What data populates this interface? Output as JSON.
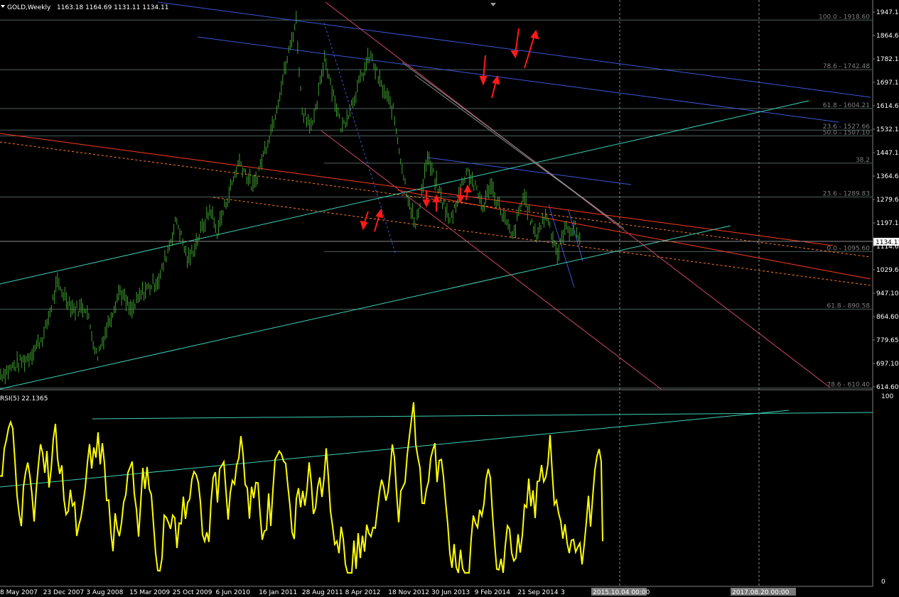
{
  "chart_data": [
    {
      "type": "bar",
      "symbol_label": "GOLD,Weekly",
      "ohlc_readout": "1163.18 1164.69 1131.11 1134.11",
      "current_price_label": "1134.11",
      "colors": {
        "bars": "#3fa02f",
        "grid": "#1c3b3b",
        "fib": "#6a6a6a",
        "channel_blue": "#3d55d6",
        "channel_red": "#ff3b22",
        "trend_cyan": "#3fd1b7",
        "pink": "#d04868",
        "arrows": "#ff1a1a",
        "rsi": "#ffff00",
        "axis_bg": "#000000"
      },
      "y_ticks": [
        "1947.10",
        "1864.60",
        "1782.15",
        "1697.10",
        "1614.60",
        "1532.10",
        "1447.10",
        "1364.60",
        "1279.65",
        "1197.10",
        "1114.60",
        "1029.65",
        "947.10",
        "864.60",
        "779.65",
        "697.10",
        "614.60"
      ],
      "ylim": [
        614.6,
        1947.1
      ],
      "fib_levels": [
        {
          "label": "100.0 - 1918.60",
          "value": 1918.6
        },
        {
          "label": "78.6 - 1742.48",
          "value": 1742.48
        },
        {
          "label": "61.8 - 1604.21",
          "value": 1604.21
        },
        {
          "label": "23.6 - 1527.66",
          "value": 1527.66
        },
        {
          "label": "50.0 - 1507.10",
          "value": 1507.1
        },
        {
          "label": "38.2",
          "value": 1410
        },
        {
          "label": "23.6 - 1289.83",
          "value": 1289.83
        },
        {
          "label": "0.0 - 1095.60",
          "value": 1095.6
        },
        {
          "label": "61.8 - 890.58",
          "value": 890.58
        },
        {
          "label": "78.6 - 610.40",
          "value": 610.4
        }
      ],
      "x_ticks": [
        "8 May 2007",
        "23 Dec 2007",
        "3 Aug 2008",
        "15 Mar 2009",
        "25 Oct 2009",
        "6 Jun 2010",
        "16 Jan 2011",
        "28 Aug 2011",
        "8 Apr 2012",
        "18 Nov 2012",
        "30 Jun 2013",
        "9 Feb 2014",
        "21 Sep 2014",
        "3"
      ],
      "x_highlights": [
        "2015.10.04 00:00",
        "2017.08.20 00:00"
      ],
      "price_path": [
        [
          "2007-05-08",
          660
        ],
        [
          "2007-10",
          720
        ],
        [
          "2007-12-23",
          800
        ],
        [
          "2008-03",
          980
        ],
        [
          "2008-06",
          890
        ],
        [
          "2008-08-03",
          900
        ],
        [
          "2008-10",
          720
        ],
        [
          "2008-12",
          840
        ],
        [
          "2009-02",
          960
        ],
        [
          "2009-04",
          880
        ],
        [
          "2009-06",
          950
        ],
        [
          "2009-09",
          1000
        ],
        [
          "2009-12",
          1210
        ],
        [
          "2010-02",
          1060
        ],
        [
          "2010-06",
          1250
        ],
        [
          "2010-07",
          1160
        ],
        [
          "2010-11",
          1420
        ],
        [
          "2011-01-16",
          1320
        ],
        [
          "2011-05",
          1560
        ],
        [
          "2011-09",
          1920
        ],
        [
          "2011-10",
          1600
        ],
        [
          "2011-12",
          1540
        ],
        [
          "2012-02",
          1790
        ],
        [
          "2012-05",
          1530
        ],
        [
          "2012-10",
          1795
        ],
        [
          "2012-12",
          1680
        ],
        [
          "2013-02",
          1600
        ],
        [
          "2013-04",
          1350
        ],
        [
          "2013-06",
          1180
        ],
        [
          "2013-08",
          1430
        ],
        [
          "2013-12",
          1200
        ],
        [
          "2014-03",
          1390
        ],
        [
          "2014-06",
          1250
        ],
        [
          "2014-07",
          1340
        ],
        [
          "2014-11",
          1140
        ],
        [
          "2015-01",
          1300
        ],
        [
          "2015-03",
          1150
        ],
        [
          "2015-05",
          1230
        ],
        [
          "2015-07",
          1080
        ],
        [
          "2015-08",
          1170
        ],
        [
          "2015-10",
          1180
        ],
        [
          "2015-11",
          1134.11
        ]
      ]
    },
    {
      "type": "line",
      "indicator_label": "RSI(5) 22.1365",
      "y_ticks": [
        "100",
        "0"
      ],
      "ylim": [
        0,
        100
      ]
    }
  ]
}
